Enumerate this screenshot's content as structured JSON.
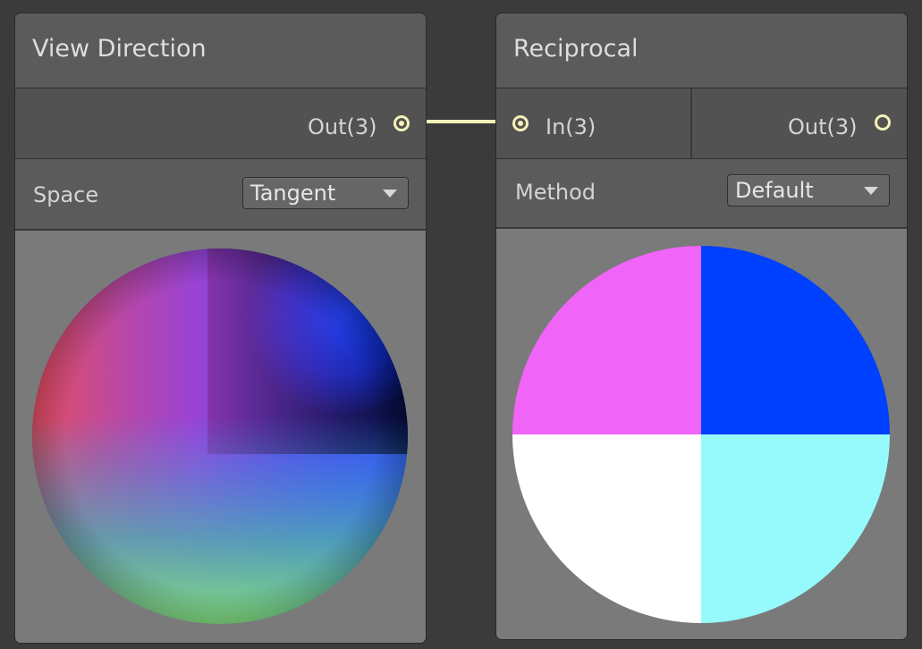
{
  "nodes": {
    "view_direction": {
      "title": "View Direction",
      "output_label": "Out(3)",
      "setting_label": "Space",
      "setting_value": "Tangent"
    },
    "reciprocal": {
      "title": "Reciprocal",
      "input_label": "In(3)",
      "output_label": "Out(3)",
      "setting_label": "Method",
      "setting_value": "Default"
    }
  },
  "colors": {
    "graph_background": "#3b3b3b",
    "title_bar": "#5b5b5b",
    "port_row": "#525252",
    "preview_background": "#7a7a7a",
    "wire_vector3": "#f3f1b6",
    "reciprocal_quadrants": [
      "#f065f8",
      "#0040ff",
      "#ffffff",
      "#96fafc"
    ]
  },
  "icons": {
    "port": "port-circle-icon",
    "dropdown": "caret-down-icon"
  }
}
